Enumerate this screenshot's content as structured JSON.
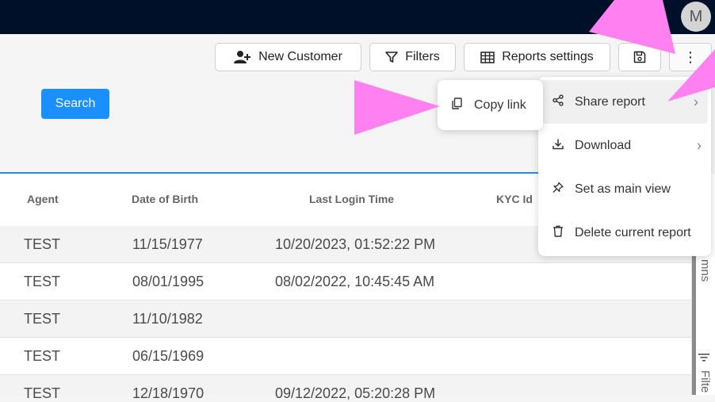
{
  "topbar": {
    "avatar_initial": "M"
  },
  "toolbar": {
    "new_customer_label": "New Customer",
    "filters_label": "Filters",
    "reports_settings_label": "Reports settings",
    "more_glyph": "⋮"
  },
  "search": {
    "label": "Search"
  },
  "table": {
    "headers": [
      "Agent",
      "Date of Birth",
      "Last Login Time",
      "KYC Id"
    ],
    "rows": [
      [
        "TEST",
        "11/15/1977",
        "10/20/2023, 01:52:22 PM"
      ],
      [
        "TEST",
        "08/01/1995",
        "08/02/2022, 10:45:45 AM"
      ],
      [
        "TEST",
        "11/10/1982",
        ""
      ],
      [
        "TEST",
        "06/15/1969",
        ""
      ],
      [
        "TEST",
        "12/18/1970",
        "09/12/2022, 05:20:28 PM"
      ]
    ]
  },
  "sidebar": {
    "columns_fragment": "mns",
    "filters_fragment": "Filte"
  },
  "menu": {
    "items": [
      {
        "label": "Share report",
        "icon": "share-icon",
        "chevron": "›"
      },
      {
        "label": "Download",
        "icon": "download-icon",
        "chevron": "›"
      },
      {
        "label": "Set as main view",
        "icon": "pin-icon"
      },
      {
        "label": "Delete current report",
        "icon": "trash-icon"
      }
    ]
  },
  "submenu": {
    "items": [
      {
        "label": "Copy link",
        "icon": "copy-icon"
      }
    ]
  },
  "colors": {
    "topbar": "#001028",
    "accent": "#1a90ff",
    "annotation_arrow": "#ff80f0"
  }
}
